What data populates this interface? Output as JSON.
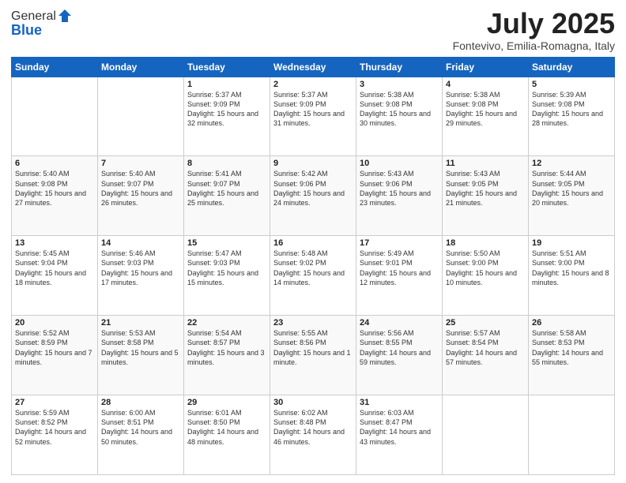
{
  "logo": {
    "general": "General",
    "blue": "Blue"
  },
  "title": "July 2025",
  "subtitle": "Fontevivo, Emilia-Romagna, Italy",
  "headers": [
    "Sunday",
    "Monday",
    "Tuesday",
    "Wednesday",
    "Thursday",
    "Friday",
    "Saturday"
  ],
  "weeks": [
    [
      {
        "day": "",
        "sunrise": "",
        "sunset": "",
        "daylight": ""
      },
      {
        "day": "",
        "sunrise": "",
        "sunset": "",
        "daylight": ""
      },
      {
        "day": "1",
        "sunrise": "Sunrise: 5:37 AM",
        "sunset": "Sunset: 9:09 PM",
        "daylight": "Daylight: 15 hours and 32 minutes."
      },
      {
        "day": "2",
        "sunrise": "Sunrise: 5:37 AM",
        "sunset": "Sunset: 9:09 PM",
        "daylight": "Daylight: 15 hours and 31 minutes."
      },
      {
        "day": "3",
        "sunrise": "Sunrise: 5:38 AM",
        "sunset": "Sunset: 9:08 PM",
        "daylight": "Daylight: 15 hours and 30 minutes."
      },
      {
        "day": "4",
        "sunrise": "Sunrise: 5:38 AM",
        "sunset": "Sunset: 9:08 PM",
        "daylight": "Daylight: 15 hours and 29 minutes."
      },
      {
        "day": "5",
        "sunrise": "Sunrise: 5:39 AM",
        "sunset": "Sunset: 9:08 PM",
        "daylight": "Daylight: 15 hours and 28 minutes."
      }
    ],
    [
      {
        "day": "6",
        "sunrise": "Sunrise: 5:40 AM",
        "sunset": "Sunset: 9:08 PM",
        "daylight": "Daylight: 15 hours and 27 minutes."
      },
      {
        "day": "7",
        "sunrise": "Sunrise: 5:40 AM",
        "sunset": "Sunset: 9:07 PM",
        "daylight": "Daylight: 15 hours and 26 minutes."
      },
      {
        "day": "8",
        "sunrise": "Sunrise: 5:41 AM",
        "sunset": "Sunset: 9:07 PM",
        "daylight": "Daylight: 15 hours and 25 minutes."
      },
      {
        "day": "9",
        "sunrise": "Sunrise: 5:42 AM",
        "sunset": "Sunset: 9:06 PM",
        "daylight": "Daylight: 15 hours and 24 minutes."
      },
      {
        "day": "10",
        "sunrise": "Sunrise: 5:43 AM",
        "sunset": "Sunset: 9:06 PM",
        "daylight": "Daylight: 15 hours and 23 minutes."
      },
      {
        "day": "11",
        "sunrise": "Sunrise: 5:43 AM",
        "sunset": "Sunset: 9:05 PM",
        "daylight": "Daylight: 15 hours and 21 minutes."
      },
      {
        "day": "12",
        "sunrise": "Sunrise: 5:44 AM",
        "sunset": "Sunset: 9:05 PM",
        "daylight": "Daylight: 15 hours and 20 minutes."
      }
    ],
    [
      {
        "day": "13",
        "sunrise": "Sunrise: 5:45 AM",
        "sunset": "Sunset: 9:04 PM",
        "daylight": "Daylight: 15 hours and 18 minutes."
      },
      {
        "day": "14",
        "sunrise": "Sunrise: 5:46 AM",
        "sunset": "Sunset: 9:03 PM",
        "daylight": "Daylight: 15 hours and 17 minutes."
      },
      {
        "day": "15",
        "sunrise": "Sunrise: 5:47 AM",
        "sunset": "Sunset: 9:03 PM",
        "daylight": "Daylight: 15 hours and 15 minutes."
      },
      {
        "day": "16",
        "sunrise": "Sunrise: 5:48 AM",
        "sunset": "Sunset: 9:02 PM",
        "daylight": "Daylight: 15 hours and 14 minutes."
      },
      {
        "day": "17",
        "sunrise": "Sunrise: 5:49 AM",
        "sunset": "Sunset: 9:01 PM",
        "daylight": "Daylight: 15 hours and 12 minutes."
      },
      {
        "day": "18",
        "sunrise": "Sunrise: 5:50 AM",
        "sunset": "Sunset: 9:00 PM",
        "daylight": "Daylight: 15 hours and 10 minutes."
      },
      {
        "day": "19",
        "sunrise": "Sunrise: 5:51 AM",
        "sunset": "Sunset: 9:00 PM",
        "daylight": "Daylight: 15 hours and 8 minutes."
      }
    ],
    [
      {
        "day": "20",
        "sunrise": "Sunrise: 5:52 AM",
        "sunset": "Sunset: 8:59 PM",
        "daylight": "Daylight: 15 hours and 7 minutes."
      },
      {
        "day": "21",
        "sunrise": "Sunrise: 5:53 AM",
        "sunset": "Sunset: 8:58 PM",
        "daylight": "Daylight: 15 hours and 5 minutes."
      },
      {
        "day": "22",
        "sunrise": "Sunrise: 5:54 AM",
        "sunset": "Sunset: 8:57 PM",
        "daylight": "Daylight: 15 hours and 3 minutes."
      },
      {
        "day": "23",
        "sunrise": "Sunrise: 5:55 AM",
        "sunset": "Sunset: 8:56 PM",
        "daylight": "Daylight: 15 hours and 1 minute."
      },
      {
        "day": "24",
        "sunrise": "Sunrise: 5:56 AM",
        "sunset": "Sunset: 8:55 PM",
        "daylight": "Daylight: 14 hours and 59 minutes."
      },
      {
        "day": "25",
        "sunrise": "Sunrise: 5:57 AM",
        "sunset": "Sunset: 8:54 PM",
        "daylight": "Daylight: 14 hours and 57 minutes."
      },
      {
        "day": "26",
        "sunrise": "Sunrise: 5:58 AM",
        "sunset": "Sunset: 8:53 PM",
        "daylight": "Daylight: 14 hours and 55 minutes."
      }
    ],
    [
      {
        "day": "27",
        "sunrise": "Sunrise: 5:59 AM",
        "sunset": "Sunset: 8:52 PM",
        "daylight": "Daylight: 14 hours and 52 minutes."
      },
      {
        "day": "28",
        "sunrise": "Sunrise: 6:00 AM",
        "sunset": "Sunset: 8:51 PM",
        "daylight": "Daylight: 14 hours and 50 minutes."
      },
      {
        "day": "29",
        "sunrise": "Sunrise: 6:01 AM",
        "sunset": "Sunset: 8:50 PM",
        "daylight": "Daylight: 14 hours and 48 minutes."
      },
      {
        "day": "30",
        "sunrise": "Sunrise: 6:02 AM",
        "sunset": "Sunset: 8:48 PM",
        "daylight": "Daylight: 14 hours and 46 minutes."
      },
      {
        "day": "31",
        "sunrise": "Sunrise: 6:03 AM",
        "sunset": "Sunset: 8:47 PM",
        "daylight": "Daylight: 14 hours and 43 minutes."
      },
      {
        "day": "",
        "sunrise": "",
        "sunset": "",
        "daylight": ""
      },
      {
        "day": "",
        "sunrise": "",
        "sunset": "",
        "daylight": ""
      }
    ]
  ]
}
